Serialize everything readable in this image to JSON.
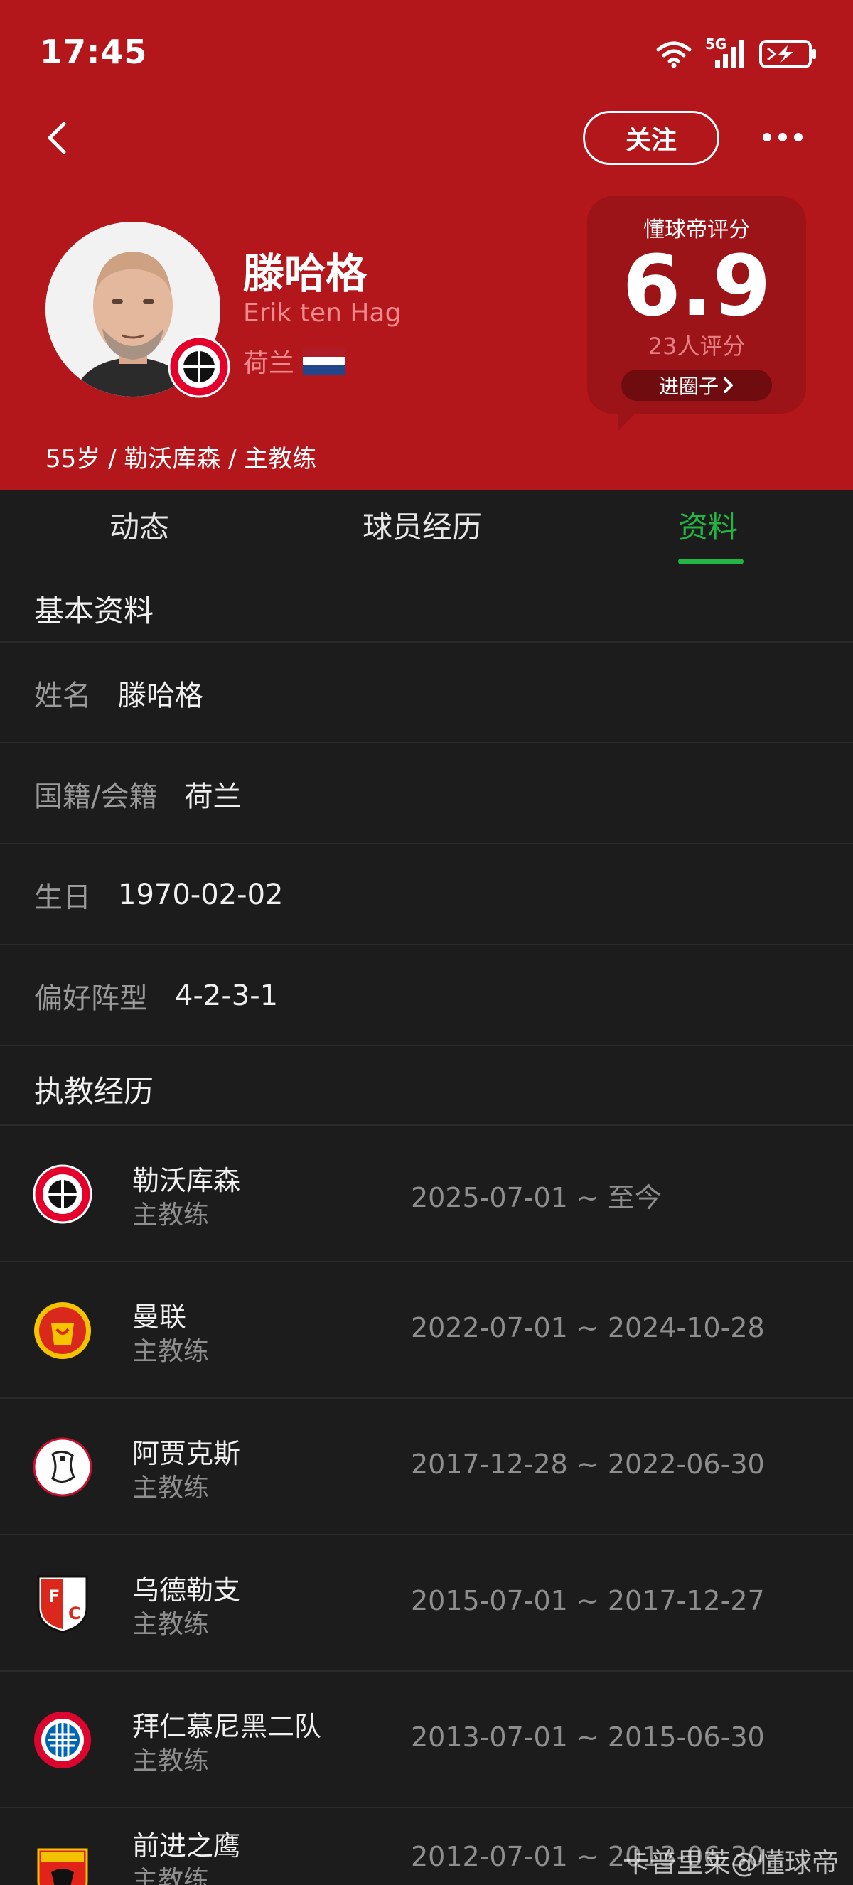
{
  "status_bar": {
    "time": "17:45",
    "network": "5G"
  },
  "header": {
    "follow_label": "关注",
    "name_cn": "滕哈格",
    "name_en": "Erik ten Hag",
    "country": "荷兰",
    "meta": "55岁 / 勒沃库森 / 主教练",
    "bg_color": "#b3161b"
  },
  "rating": {
    "title": "懂球帝评分",
    "score": "6.9",
    "count": "23人评分",
    "circle_label": "进圈子"
  },
  "tabs": [
    {
      "label": "动态",
      "active": false
    },
    {
      "label": "球员经历",
      "active": false
    },
    {
      "label": "资料",
      "active": true
    }
  ],
  "accent_color": "#22b543",
  "basic": {
    "title": "基本资料",
    "rows": [
      {
        "label": "姓名",
        "value": "滕哈格"
      },
      {
        "label": "国籍/会籍",
        "value": "荷兰"
      },
      {
        "label": "生日",
        "value": "1970-02-02"
      },
      {
        "label": "偏好阵型",
        "value": "4-2-3-1"
      }
    ]
  },
  "career": {
    "title": "执教经历",
    "rows": [
      {
        "club": "勒沃库森",
        "role": "主教练",
        "period": "2025-07-01 ~ 至今",
        "logo": "leverkusen-logo"
      },
      {
        "club": "曼联",
        "role": "主教练",
        "period": "2022-07-01 ~ 2024-10-28",
        "logo": "man-utd-logo"
      },
      {
        "club": "阿贾克斯",
        "role": "主教练",
        "period": "2017-12-28 ~ 2022-06-30",
        "logo": "ajax-logo"
      },
      {
        "club": "乌德勒支",
        "role": "主教练",
        "period": "2015-07-01 ~ 2017-12-27",
        "logo": "utrecht-logo"
      },
      {
        "club": "拜仁慕尼黑二队",
        "role": "主教练",
        "period": "2013-07-01 ~ 2015-06-30",
        "logo": "bayern-logo"
      },
      {
        "club": "前进之鹰",
        "role": "主教练",
        "period": "2012-07-01 ~ 2013-06-30",
        "logo": "go-ahead-eagles-logo"
      }
    ]
  },
  "watermark": "卡普里莱@懂球帝"
}
